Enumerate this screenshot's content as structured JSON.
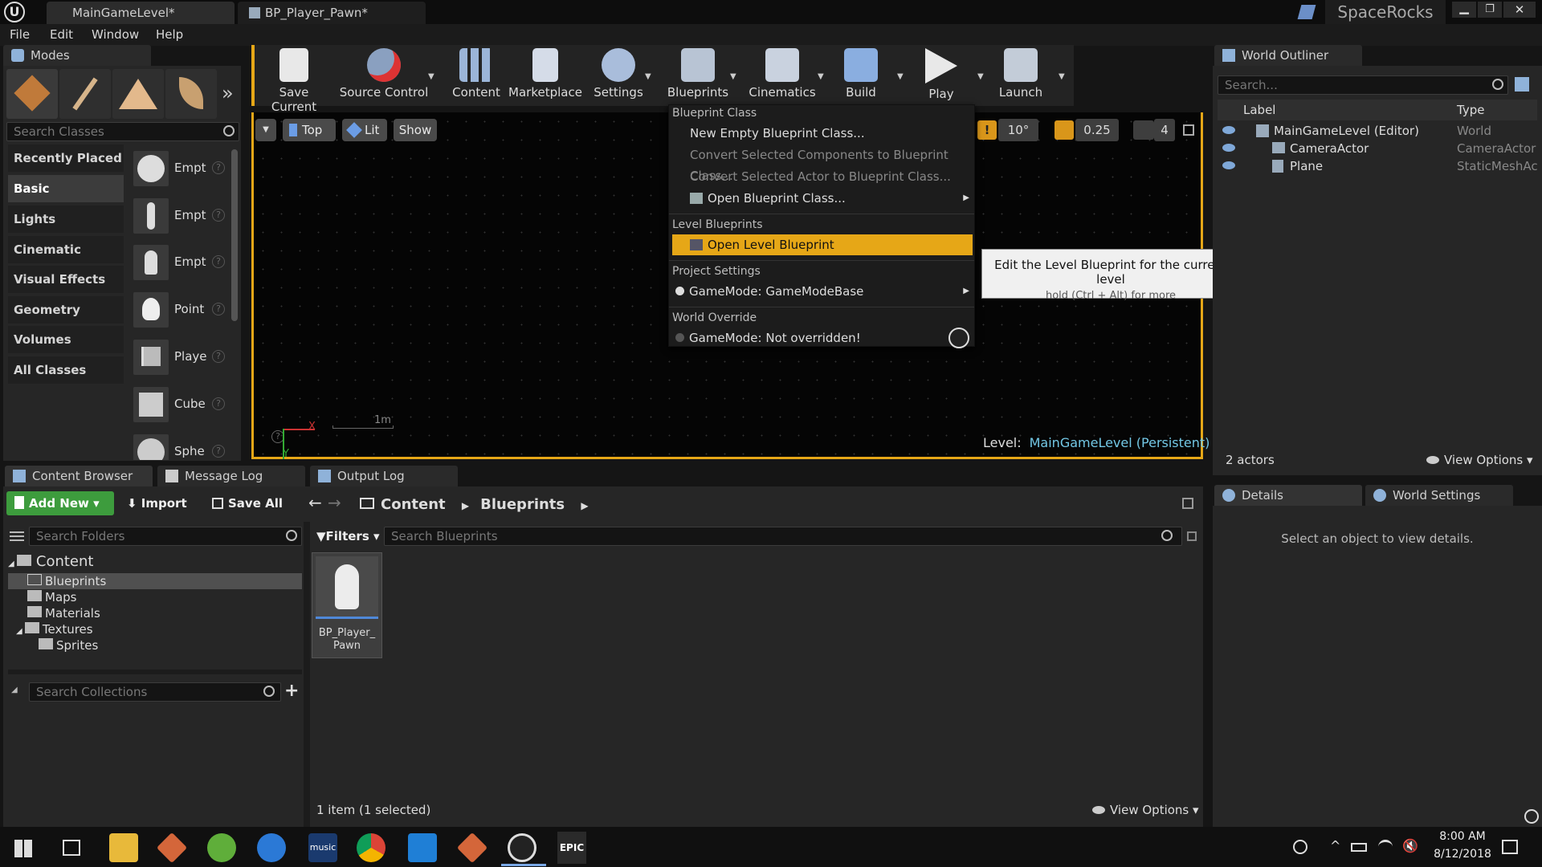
{
  "titlebar": {
    "tabs": [
      "MainGameLevel*",
      "BP_Player_Pawn*"
    ],
    "project": "SpaceRocks"
  },
  "menubar": {
    "items": [
      "File",
      "Edit",
      "Window",
      "Help"
    ]
  },
  "modes": {
    "title": "Modes",
    "search_placeholder": "Search Classes",
    "categories": [
      "Recently Placed",
      "Basic",
      "Lights",
      "Cinematic",
      "Visual Effects",
      "Geometry",
      "Volumes",
      "All Classes"
    ],
    "items": [
      "Empt",
      "Empt",
      "Empt",
      "Point",
      "Playe",
      "Cube",
      "Sphe"
    ]
  },
  "toolbar": {
    "buttons": [
      "Save Current",
      "Source Control",
      "Content",
      "Marketplace",
      "Settings",
      "Blueprints",
      "Cinematics",
      "Build",
      "Play",
      "Launch"
    ]
  },
  "viewport": {
    "view_top": "Top",
    "view_lit": "Lit",
    "view_show": "Show",
    "angle": "10°",
    "scale": "0.25",
    "camspeed": "4",
    "scale_label": "1m",
    "level_label": "Level:",
    "level_name": "MainGameLevel (Persistent)"
  },
  "dropdown": {
    "h_bp_class": "Blueprint Class",
    "new_empty": "New Empty Blueprint Class...",
    "convert_components": "Convert Selected Components to Blueprint Class...",
    "convert_actor": "Convert Selected Actor to Blueprint Class...",
    "open_bp_class": "Open Blueprint Class...",
    "h_level": "Level Blueprints",
    "open_level": "Open Level Blueprint",
    "h_project": "Project Settings",
    "gamemode": "GameMode: GameModeBase",
    "h_world": "World Override",
    "world_gamemode": "GameMode: Not overridden!"
  },
  "tooltip": {
    "line1": "Edit the Level Blueprint for the current level",
    "line2": "hold (Ctrl + Alt) for more"
  },
  "outliner": {
    "title": "World Outliner",
    "search_placeholder": "Search...",
    "col_label": "Label",
    "col_type": "Type",
    "rows": [
      {
        "label": "MainGameLevel (Editor)",
        "type": "World"
      },
      {
        "label": "CameraActor",
        "type": "CameraActor"
      },
      {
        "label": "Plane",
        "type": "StaticMeshActo"
      }
    ],
    "actors": "2 actors",
    "view_options": "View Options"
  },
  "details": {
    "tab_details": "Details",
    "tab_world": "World Settings",
    "empty": "Select an object to view details."
  },
  "bottomtabs": {
    "content_browser": "Content Browser",
    "message_log": "Message Log",
    "output_log": "Output Log"
  },
  "content": {
    "add_new": "Add New",
    "import": "Import",
    "save_all": "Save All",
    "crumb1": "Content",
    "crumb2": "Blueprints",
    "search_folders": "Search Folders",
    "filters": "Filters",
    "search_blueprints": "Search Blueprints",
    "tree": [
      "Content",
      "Blueprints",
      "Maps",
      "Materials",
      "Textures",
      "Sprites"
    ],
    "search_collections": "Search Collections",
    "asset_line1": "BP_Player_",
    "asset_line2": "Pawn",
    "status": "1 item (1 selected)",
    "view_options": "View Options"
  },
  "taskbar": {
    "time": "8:00 AM",
    "date": "8/12/2018",
    "epic": "EPIC",
    "music": "music"
  },
  "colors": {
    "accent": "#e6a717",
    "bg": "#262626"
  }
}
